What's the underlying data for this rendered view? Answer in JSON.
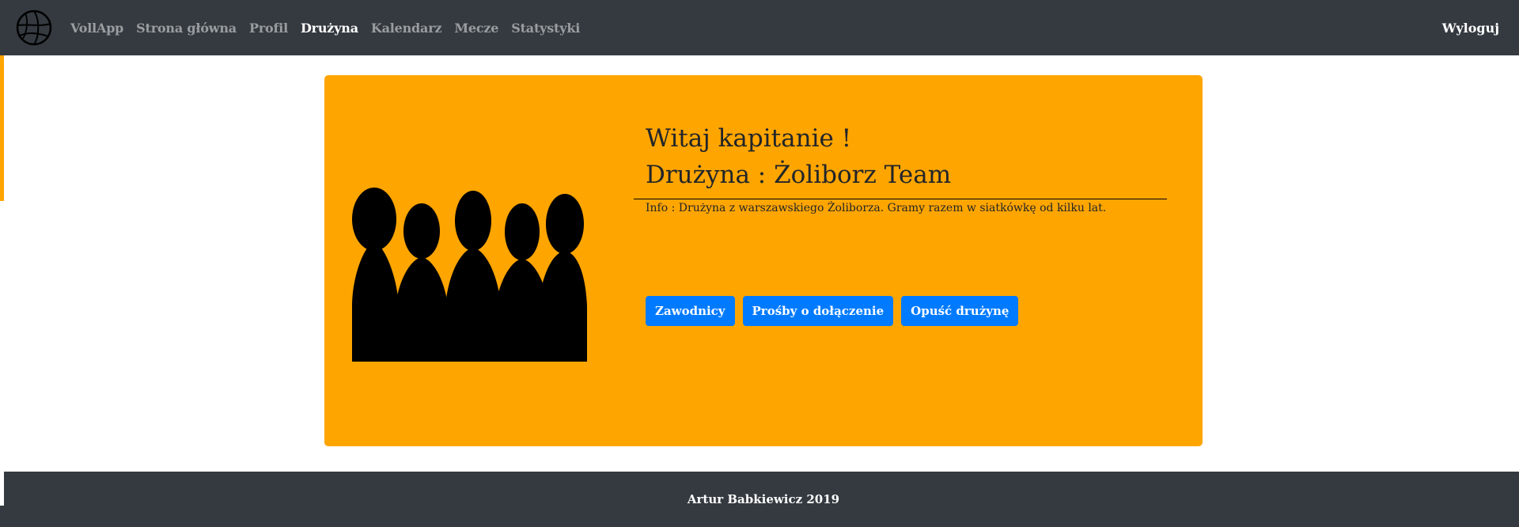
{
  "colors": {
    "navbar_bg": "#343a40",
    "jumbotron_bg": "#ffa500",
    "button_bg": "#007bff",
    "text_dark": "#212529"
  },
  "navbar": {
    "logo_icon": "volleyball-icon",
    "brand": "VollApp",
    "items": [
      {
        "label": "Strona główna",
        "active": false
      },
      {
        "label": "Profil",
        "active": false
      },
      {
        "label": "Drużyna",
        "active": true
      },
      {
        "label": "Kalendarz",
        "active": false
      },
      {
        "label": "Mecze",
        "active": false
      },
      {
        "label": "Statystyki",
        "active": false
      }
    ],
    "logout": "Wyloguj"
  },
  "team": {
    "graphic_icon": "team-silhouette-icon",
    "greeting": "Witaj kapitanie !",
    "name": "Drużyna : Żoliborz Team",
    "info": "Info : Drużyna z warszawskiego Żoliborza. Gramy razem w siatkówkę od kilku lat.",
    "buttons": {
      "players": "Zawodnicy",
      "join_requests": "Prośby o dołączenie",
      "leave_team": "Opuść drużynę"
    }
  },
  "footer": {
    "text": "Artur Babkiewicz 2019"
  }
}
